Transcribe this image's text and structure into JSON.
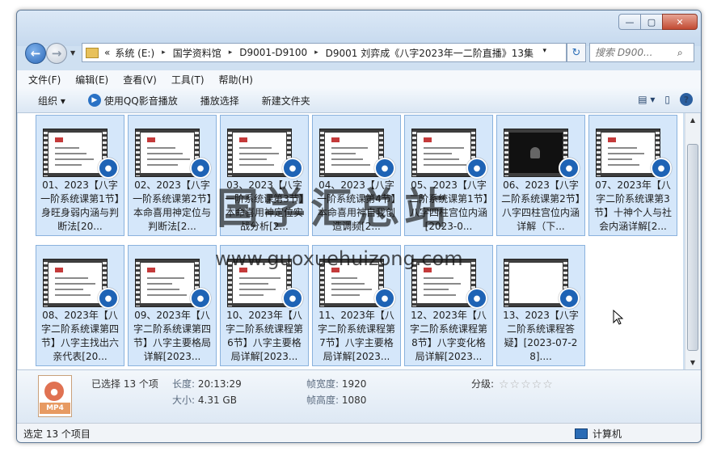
{
  "window": {
    "min_label": "—",
    "max_label": "▢",
    "close_label": "✕"
  },
  "address": {
    "overflow": "«",
    "crumbs": [
      "系统 (E:)",
      "国学资料馆",
      "D9001-D9100",
      "D9001 刘弈成《八字2023年一二阶直播》13集"
    ],
    "separator": "▸",
    "dropdown": "▾"
  },
  "search": {
    "placeholder": "搜索 D900..."
  },
  "menu": [
    "文件(F)",
    "编辑(E)",
    "查看(V)",
    "工具(T)",
    "帮助(H)"
  ],
  "toolbar": {
    "organize": "组织 ▾",
    "play_qq": "使用QQ影音播放",
    "play_select": "播放选择",
    "new_folder": "新建文件夹",
    "view_icon": "▤ ▾",
    "pane_icon": "▯",
    "help": "?"
  },
  "files": [
    {
      "label": "01、2023【八字一阶系统课第1节】身旺身弱内涵与判断法[20...",
      "thumb": "light"
    },
    {
      "label": "02、2023【八字一阶系统课第2节】本命喜用神定位与判断法[2...",
      "thumb": "light"
    },
    {
      "label": "03、2023【八字一阶系统课第3节】本命喜用神定位实战分析[2...",
      "thumb": "light"
    },
    {
      "label": "04、2023【八字一阶系统课第4节】本命喜用神自我创造调频[2...",
      "thumb": "light"
    },
    {
      "label": "05、2023【八字二阶系统课第1节】八字四柱宫位内涵[2023-0...",
      "thumb": "light"
    },
    {
      "label": "06、2023【八字二阶系统课第2节】八字四柱宫位内涵详解（下...",
      "thumb": "dark"
    },
    {
      "label": "07、2023年【八字二阶系统课第3节】十神个人与社会内涵详解[2...",
      "thumb": "light"
    },
    {
      "label": "08、2023年【八字二阶系统课第四节】八字主找出六亲代表[20...",
      "thumb": "light"
    },
    {
      "label": "09、2023年【八字二阶系统课第四节】八字主要格局详解[2023...",
      "thumb": "light"
    },
    {
      "label": "10、2023年【八字二阶系统课程第6节】八字主要格局详解[2023...",
      "thumb": "light"
    },
    {
      "label": "11、2023年【八字二阶系统课程第7节】八字主要格局详解[2023...",
      "thumb": "light"
    },
    {
      "label": "12、2023年【八字二阶系统课程第8节】八字变化格局详解[2023...",
      "thumb": "light"
    },
    {
      "label": "13、2023【八字二阶系统课程答疑】[2023-07-28]....",
      "thumb": "blank"
    }
  ],
  "details": {
    "selected": "已选择 13 个项",
    "length_label": "长度:",
    "length_value": "20:13:29",
    "size_label": "大小:",
    "size_value": "4.31 GB",
    "fw_label": "帧宽度:",
    "fw_value": "1920",
    "fh_label": "帧高度:",
    "fh_value": "1080",
    "rating_label": "分级:",
    "stars": "☆☆☆☆☆",
    "file_type": "MP4"
  },
  "status": {
    "left": "选定 13 个项目",
    "right": "计算机"
  },
  "watermark": {
    "title": "国学汇总站",
    "url": "www.guoxuehuizong.com"
  }
}
